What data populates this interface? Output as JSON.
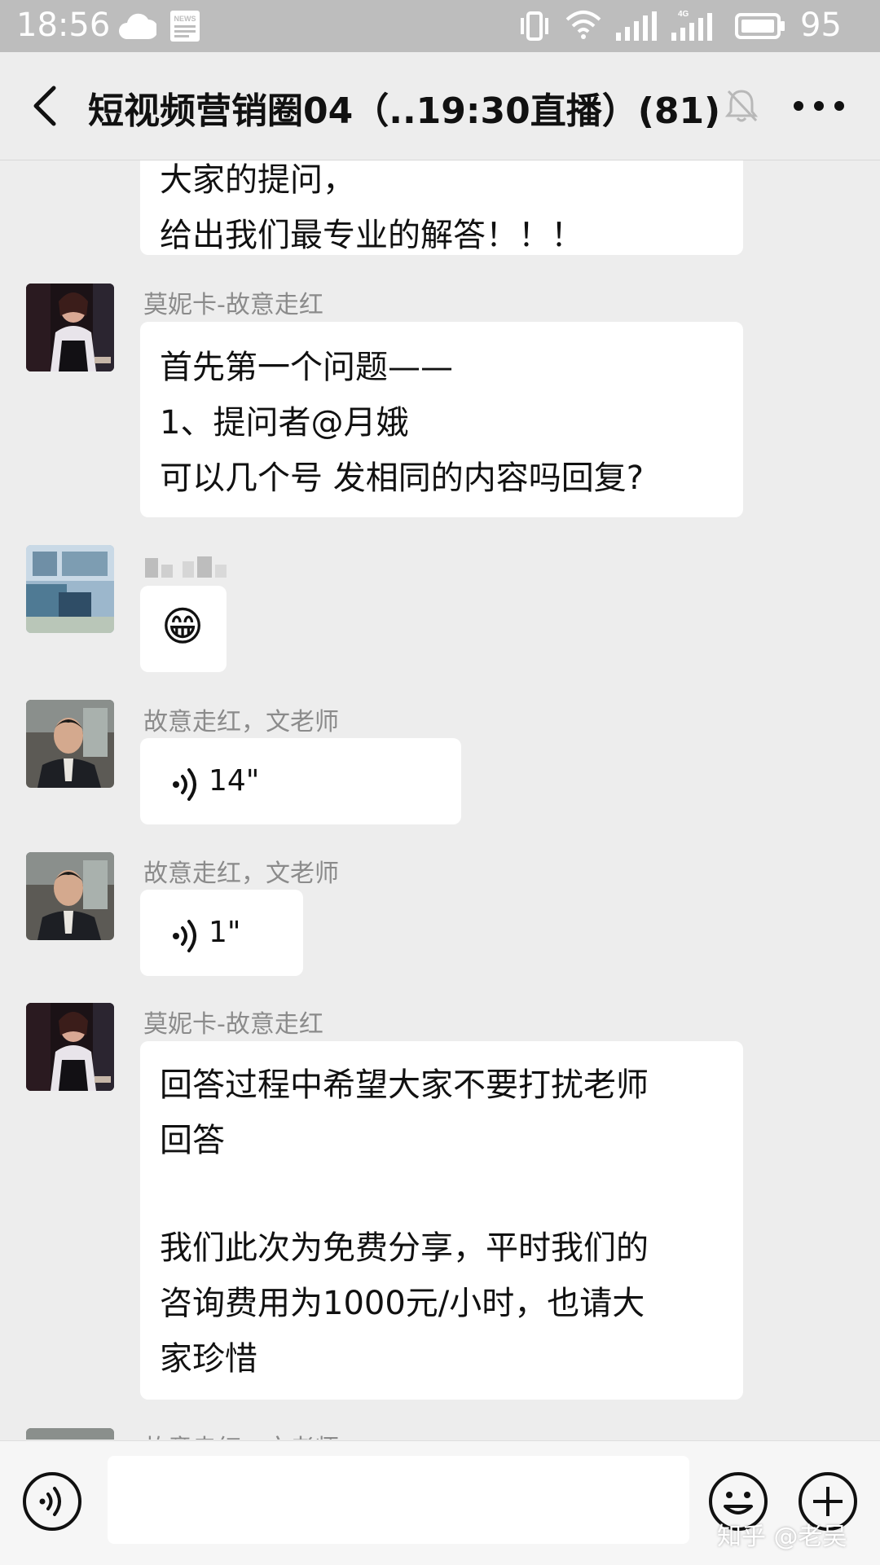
{
  "status_bar": {
    "time": "18:56",
    "news_label": "NEWS",
    "network_label": "4G",
    "battery": "95"
  },
  "header": {
    "title": "短视频营销圈04（..19:30直播）(81)"
  },
  "messages": [
    {
      "type": "text",
      "lines": [
        "大家的提问，",
        "给出我们最专业的解答！！！"
      ]
    },
    {
      "sender": "莫妮卡-故意走红",
      "type": "text",
      "lines": [
        "首先第一个问题——",
        "1、提问者@月娥",
        "可以几个号 发相同的内容吗回复?"
      ]
    },
    {
      "sender": "",
      "type": "emoji",
      "emoji": "😁"
    },
    {
      "sender": "故意走红，文老师",
      "type": "voice",
      "duration": "14\""
    },
    {
      "sender": "故意走红，文老师",
      "type": "voice",
      "duration": "1\""
    },
    {
      "sender": "莫妮卡-故意走红",
      "type": "text",
      "lines": [
        "回答过程中希望大家不要打扰老师",
        "回答",
        "",
        "我们此次为免费分享，平时我们的",
        "咨询费用为1000元/小时，也请大",
        "家珍惜"
      ]
    },
    {
      "sender": "故意走红，文老师",
      "type": "partial"
    }
  ],
  "input_bar": {
    "placeholder": "",
    "watermark": "知乎 @老吴"
  }
}
